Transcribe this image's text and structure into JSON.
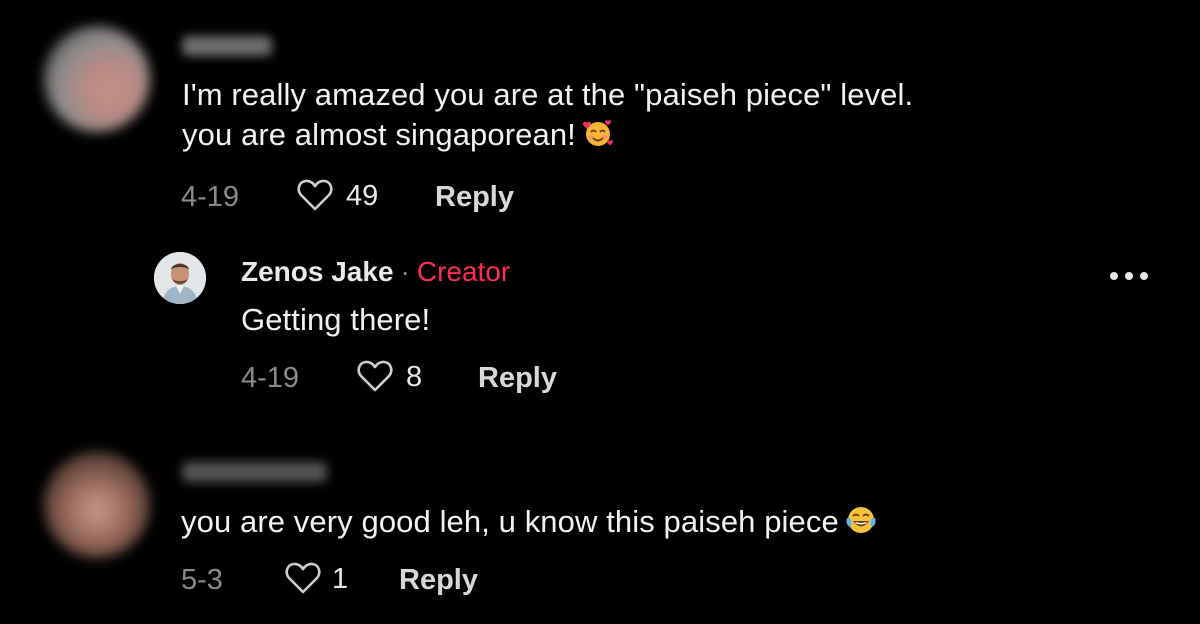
{
  "comments": [
    {
      "text_line1": "I'm really amazed you are at the \"paiseh piece\" level.",
      "text_line2": "you are almost singaporean!",
      "emoji": "smiling-face-with-hearts",
      "date": "4-19",
      "likes": "49",
      "reply_label": "Reply"
    },
    {
      "author": "Zenos Jake",
      "separator": "·",
      "badge": "Creator",
      "text": "Getting there!",
      "date": "4-19",
      "likes": "8",
      "reply_label": "Reply"
    },
    {
      "text": "you are very good leh, u know this paiseh piece",
      "emoji": "face-with-tears-of-joy",
      "date": "5-3",
      "likes": "1",
      "reply_label": "Reply"
    }
  ],
  "colors": {
    "background": "#000000",
    "creator_badge": "#fe2c55",
    "meta_text": "#8a8a8a"
  }
}
